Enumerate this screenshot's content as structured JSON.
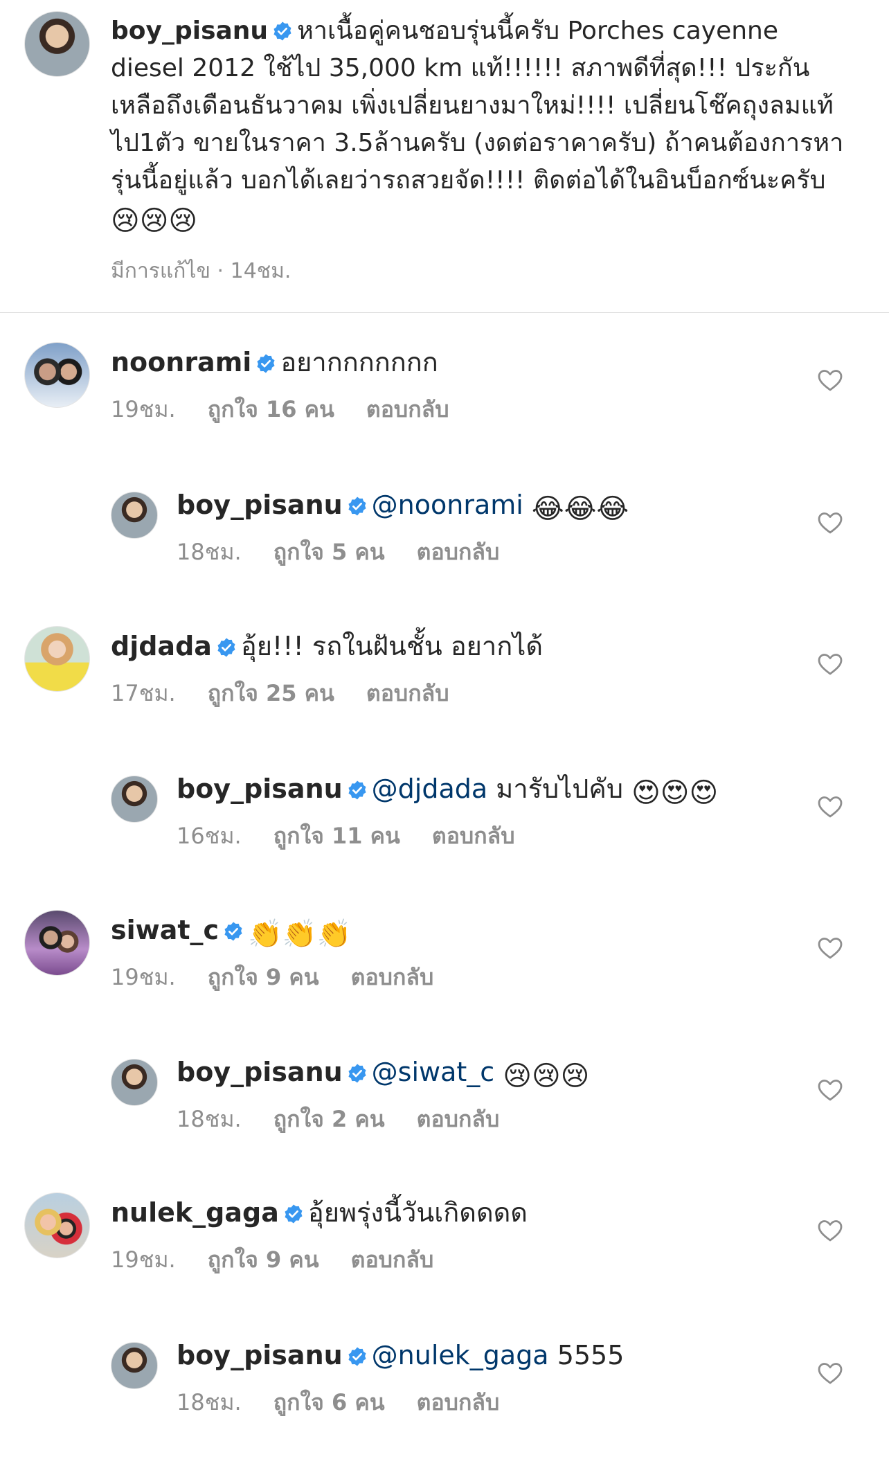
{
  "post": {
    "username": "boy_pisanu",
    "caption": "หาเนื้อคู่คนชอบรุ่นนี้ครับ Porches cayenne diesel 2012 ใช้ไป 35,000 km แท้!!!!!! สภาพดีที่สุด!!! ประกันเหลือถึงเดือนธันวาคม เพิ่งเปลี่ยนยางมาใหม่!!!! เปลี่ยนโช๊คถุงลมแท้ไป1ตัว ขายในราคา 3.5ล้านครับ (งดต่อราคาครับ) ถ้าคนต้องการหารุ่นนี้อยู่แล้ว บอกได้เลยว่ารถสวยจัด!!!! ติดต่อได้ในอินบ็อกซ์นะครับ",
    "caption_emoji": "😢😢😢",
    "edited_label": "มีการแก้ไข",
    "time": "14ชม."
  },
  "labels": {
    "reply": "ตอบกลับ"
  },
  "comments": [
    {
      "username": "noonrami",
      "text": "อยากกกกกกก",
      "mention": "",
      "emoji": "",
      "time": "19ชม.",
      "likes": "ถูกใจ 16 คน"
    },
    {
      "username": "boy_pisanu",
      "text": "",
      "mention": "@noonrami",
      "emoji": "😂😂😂",
      "time": "18ชม.",
      "likes": "ถูกใจ 5 คน"
    },
    {
      "username": "djdada",
      "text": "อุ้ย!!! รถในฝันชั้น อยากได้",
      "mention": "",
      "emoji": "",
      "time": "17ชม.",
      "likes": "ถูกใจ 25 คน"
    },
    {
      "username": "boy_pisanu",
      "text": "มารับไปคับ",
      "mention": "@djdada",
      "emoji": "😍😍😍",
      "time": "16ชม.",
      "likes": "ถูกใจ 11 คน"
    },
    {
      "username": "siwat_c",
      "text": "",
      "mention": "",
      "emoji": "👏👏👏",
      "time": "19ชม.",
      "likes": "ถูกใจ 9 คน"
    },
    {
      "username": "boy_pisanu",
      "text": "",
      "mention": "@siwat_c",
      "emoji": "😢😢😢",
      "time": "18ชม.",
      "likes": "ถูกใจ 2 คน"
    },
    {
      "username": "nulek_gaga",
      "text": "อุ้ยพรุ่งนี้วันเกิดดดด",
      "mention": "",
      "emoji": "",
      "time": "19ชม.",
      "likes": "ถูกใจ 9 คน"
    },
    {
      "username": "boy_pisanu",
      "text": "5555",
      "mention": "@nulek_gaga",
      "emoji": "",
      "time": "18ชม.",
      "likes": "ถูกใจ 6 คน"
    }
  ],
  "icons": {
    "verified": "verified-badge-icon",
    "like": "heart-outline-icon"
  },
  "colors": {
    "verified_blue": "#3897f0",
    "mention": "#00376b",
    "meta_gray": "#8e8e8e"
  }
}
